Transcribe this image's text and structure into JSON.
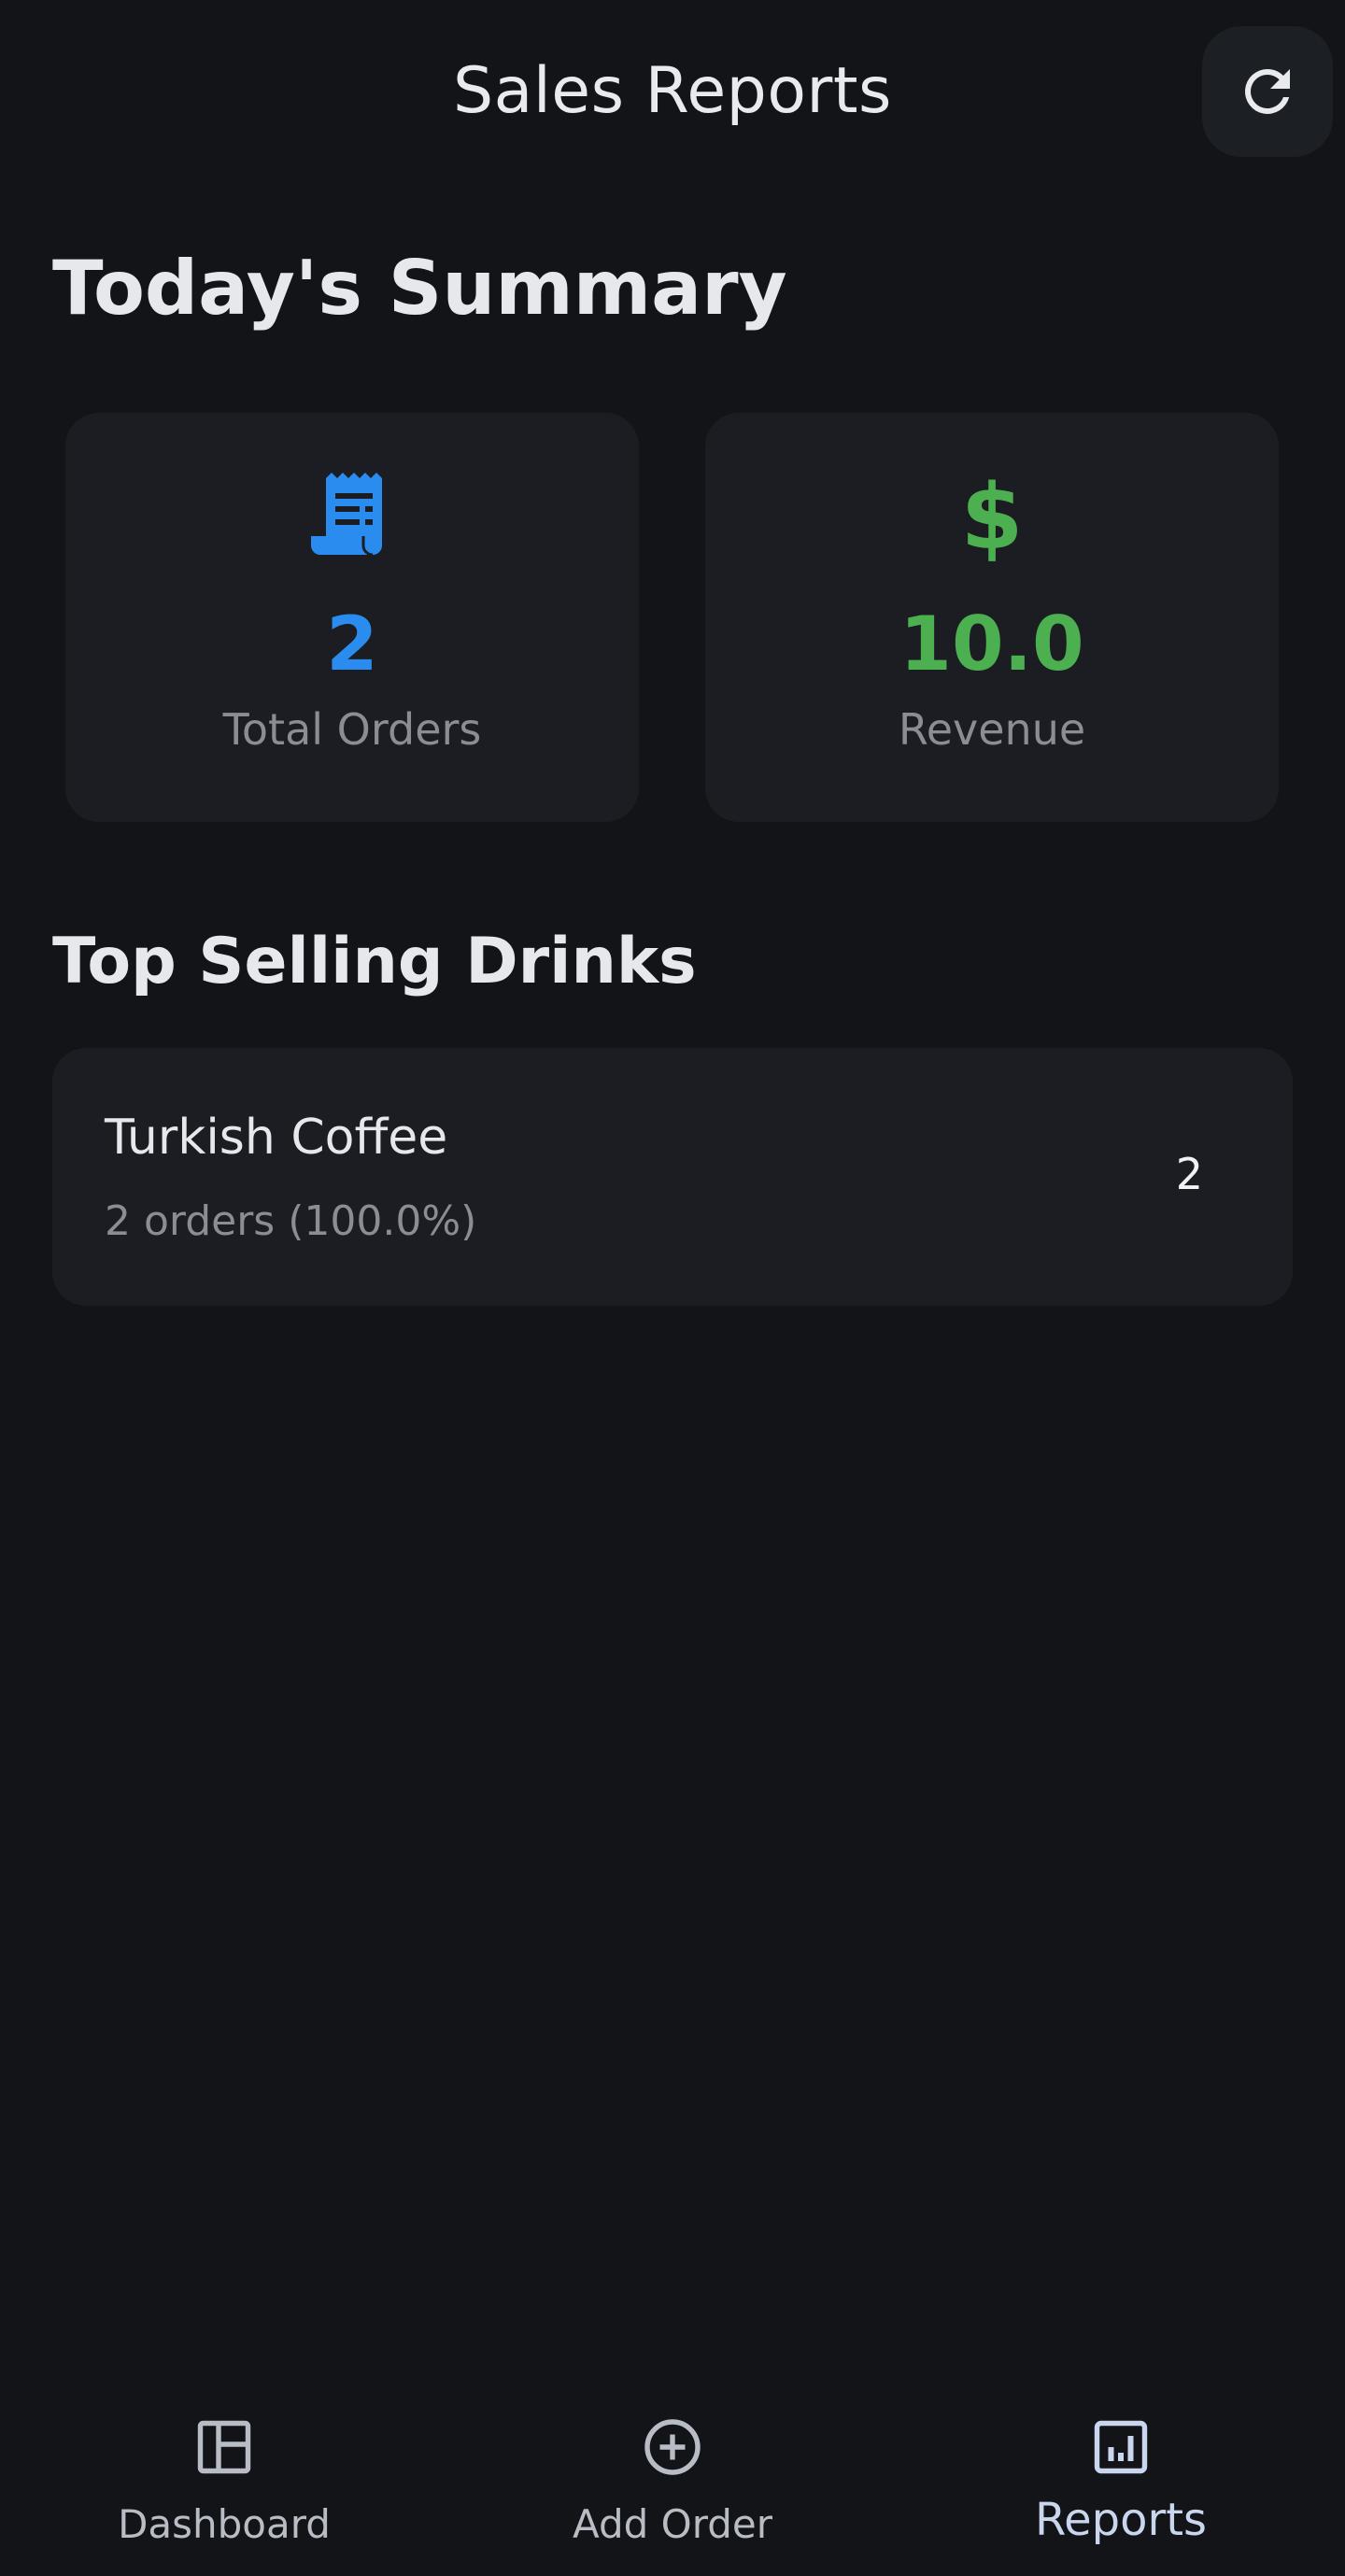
{
  "header": {
    "title": "Sales Reports",
    "refresh_icon": "refresh-icon"
  },
  "summary": {
    "title": "Today's Summary",
    "cards": [
      {
        "icon": "receipt-icon",
        "value": "2",
        "label": "Total Orders",
        "color": "#2b8cf0"
      },
      {
        "icon": "dollar-icon",
        "glyph": "$",
        "value": "10.0",
        "label": "Revenue",
        "color": "#4caf50"
      }
    ]
  },
  "top_selling": {
    "title": "Top Selling Drinks",
    "items": [
      {
        "name": "Turkish Coffee",
        "subtitle": "2 orders (100.0%)",
        "count": "2"
      }
    ]
  },
  "bottom_nav": {
    "items": [
      {
        "label": "Dashboard",
        "icon": "dashboard-icon",
        "active": false
      },
      {
        "label": "Add Order",
        "icon": "add-circle-icon",
        "active": false
      },
      {
        "label": "Reports",
        "icon": "bar-chart-icon",
        "active": true
      }
    ]
  },
  "colors": {
    "background": "#121418",
    "card": "#1b1d22",
    "accent_blue": "#2b8cf0",
    "accent_green": "#4caf50",
    "muted_text": "#8a8d93"
  }
}
